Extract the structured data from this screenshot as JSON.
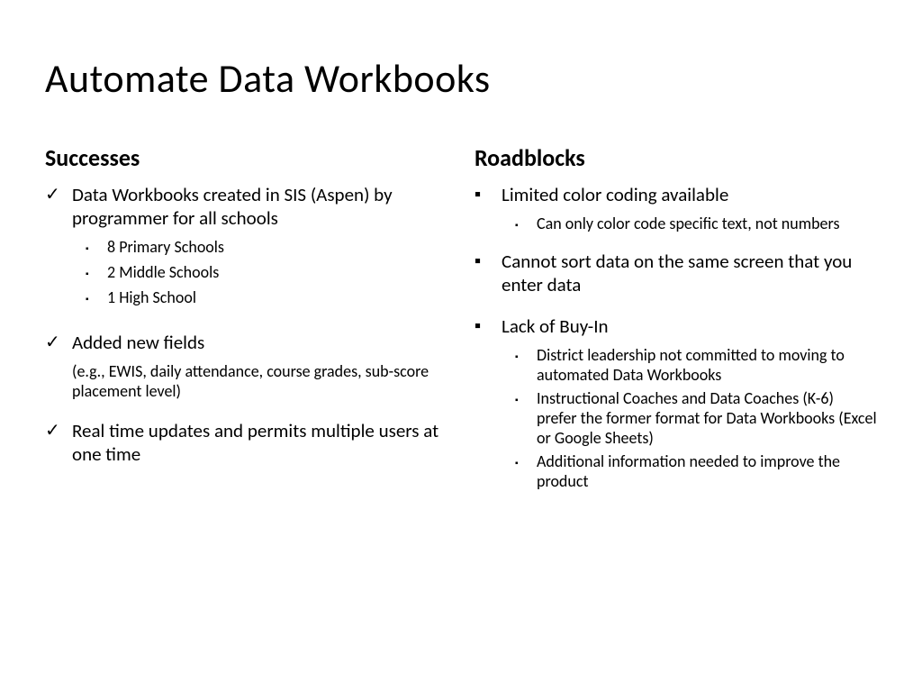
{
  "title": "Automate Data Workbooks",
  "left": {
    "heading": "Successes",
    "items": [
      {
        "bullet": "check",
        "text": "Data Workbooks created in SIS (Aspen) by programmer for all schools",
        "sub": [
          "8 Primary Schools",
          "2 Middle Schools",
          "1 High School"
        ]
      },
      {
        "bullet": "check",
        "text": "Added new fields",
        "note": "(e.g., EWIS, daily attendance, course grades, sub-score placement level)"
      },
      {
        "bullet": "check",
        "text": "Real time updates and permits multiple users at one time"
      }
    ]
  },
  "right": {
    "heading": "Roadblocks",
    "items": [
      {
        "bullet": "square",
        "text": "Limited color coding available",
        "sub": [
          "Can only color code specific text, not numbers"
        ]
      },
      {
        "bullet": "square",
        "text": "Cannot sort data on the same screen that you enter data"
      },
      {
        "bullet": "square",
        "text": "Lack of Buy-In",
        "sub": [
          "District leadership not committed to moving to automated Data Workbooks",
          "Instructional Coaches and Data Coaches (K-6) prefer the former format for Data Workbooks (Excel or Google Sheets)",
          "Additional information needed to improve the product"
        ]
      }
    ]
  }
}
